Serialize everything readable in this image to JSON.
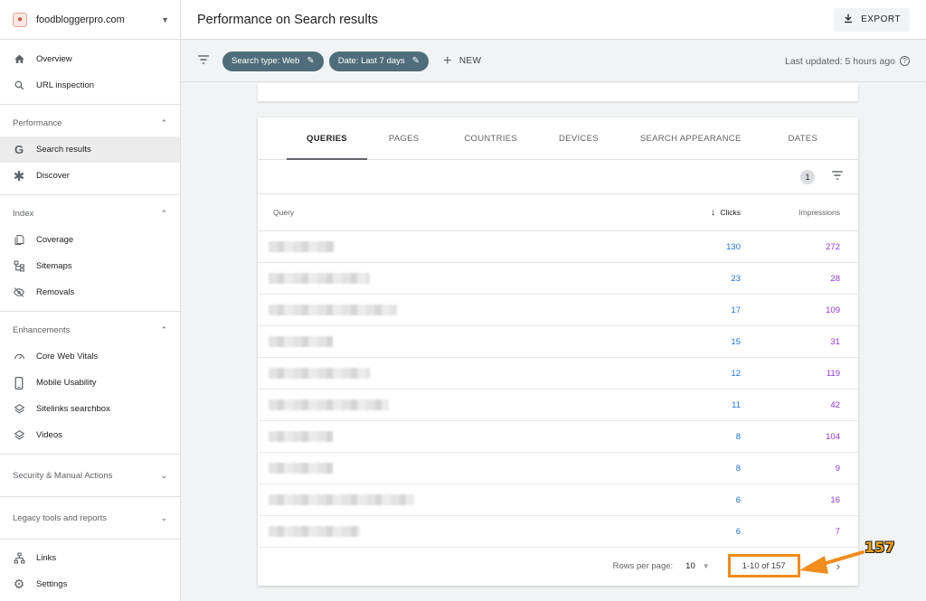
{
  "property": {
    "name": "foodbloggerpro.com"
  },
  "sidebar": {
    "top_items": [
      {
        "label": "Overview",
        "icon": "home-icon"
      },
      {
        "label": "URL inspection",
        "icon": "search-icon"
      }
    ],
    "sections": {
      "performance": {
        "label": "Performance",
        "items": [
          "Search results",
          "Discover"
        ]
      },
      "index": {
        "label": "Index",
        "items": [
          "Coverage",
          "Sitemaps",
          "Removals"
        ]
      },
      "enhancements": {
        "label": "Enhancements",
        "items": [
          "Core Web Vitals",
          "Mobile Usability",
          "Sitelinks searchbox",
          "Videos"
        ]
      },
      "security": {
        "label": "Security & Manual Actions"
      },
      "legacy": {
        "label": "Legacy tools and reports"
      }
    },
    "bottom_items": [
      "Links",
      "Settings"
    ]
  },
  "header": {
    "title": "Performance on Search results",
    "export_label": "EXPORT"
  },
  "filters": {
    "chips": [
      "Search type: Web",
      "Date: Last 7 days"
    ],
    "new_label": "NEW",
    "last_updated": "Last updated: 5 hours ago"
  },
  "table": {
    "tabs": [
      "QUERIES",
      "PAGES",
      "COUNTRIES",
      "DEVICES",
      "SEARCH APPEARANCE",
      "DATES"
    ],
    "active_tab": "QUERIES",
    "filter_count": "1",
    "columns": {
      "query": "Query",
      "clicks": "Clicks",
      "impressions": "Impressions"
    },
    "rows": [
      {
        "clicks": "130",
        "impressions": "272",
        "blur_width": 0.34
      },
      {
        "clicks": "23",
        "impressions": "28",
        "blur_width": 0.52
      },
      {
        "clicks": "17",
        "impressions": "109",
        "blur_width": 0.66
      },
      {
        "clicks": "15",
        "impressions": "31",
        "blur_width": 0.33
      },
      {
        "clicks": "12",
        "impressions": "119",
        "blur_width": 0.52
      },
      {
        "clicks": "11",
        "impressions": "42",
        "blur_width": 0.62
      },
      {
        "clicks": "8",
        "impressions": "104",
        "blur_width": 0.33
      },
      {
        "clicks": "8",
        "impressions": "9",
        "blur_width": 0.33
      },
      {
        "clicks": "6",
        "impressions": "16",
        "blur_width": 0.75
      },
      {
        "clicks": "6",
        "impressions": "7",
        "blur_width": 0.47
      }
    ],
    "footer": {
      "rows_per_page_label": "Rows per page:",
      "rows_per_page": "10",
      "range": "1-10 of 157"
    }
  },
  "annotation": {
    "label": "157",
    "color": "#f28c1c"
  },
  "colors": {
    "clicks": "#1a73e8",
    "impressions": "#9334e6",
    "chip": "#4f6d7a"
  }
}
